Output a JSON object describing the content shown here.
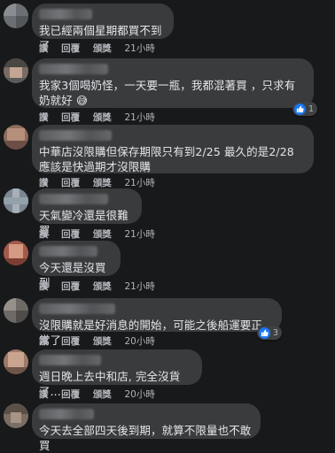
{
  "actions": {
    "like": "讚",
    "reply": "回覆",
    "share": "頒獎"
  },
  "comments": [
    {
      "text": "我已經兩個星期都買不到了",
      "time": "21小時"
    },
    {
      "text": "我家3個喝奶怪，一天要一瓶，我都混著買 ，只求有奶就好 😅",
      "time": "21小時",
      "reaction_count": "1"
    },
    {
      "text": "中華店沒限購但保存期限只有到2/25 最久的是2/28 應該是快過期才沒限購",
      "time": "21小時"
    },
    {
      "text": "天氣變冷還是很難買",
      "time": "21小時"
    },
    {
      "text": "今天還是沒買到",
      "time": "21小時"
    },
    {
      "text": "沒限購就是好消息的開始，可能之後船運要正常了",
      "time": "20小時",
      "reaction_count": "3"
    },
    {
      "text": "週日晚上去中和店, 完全沒貨了.....",
      "time": "20小時"
    },
    {
      "text": "今天去全部四天後到期，就算不限量也不敢買",
      "time": ""
    }
  ],
  "colors": {
    "background": "#18191a",
    "bubble": "#3a3b3c",
    "text": "#e4e6eb",
    "meta": "#b0b3b8",
    "like": "#1877f2"
  },
  "icons": {
    "reaction": "thumbs-up-icon"
  }
}
